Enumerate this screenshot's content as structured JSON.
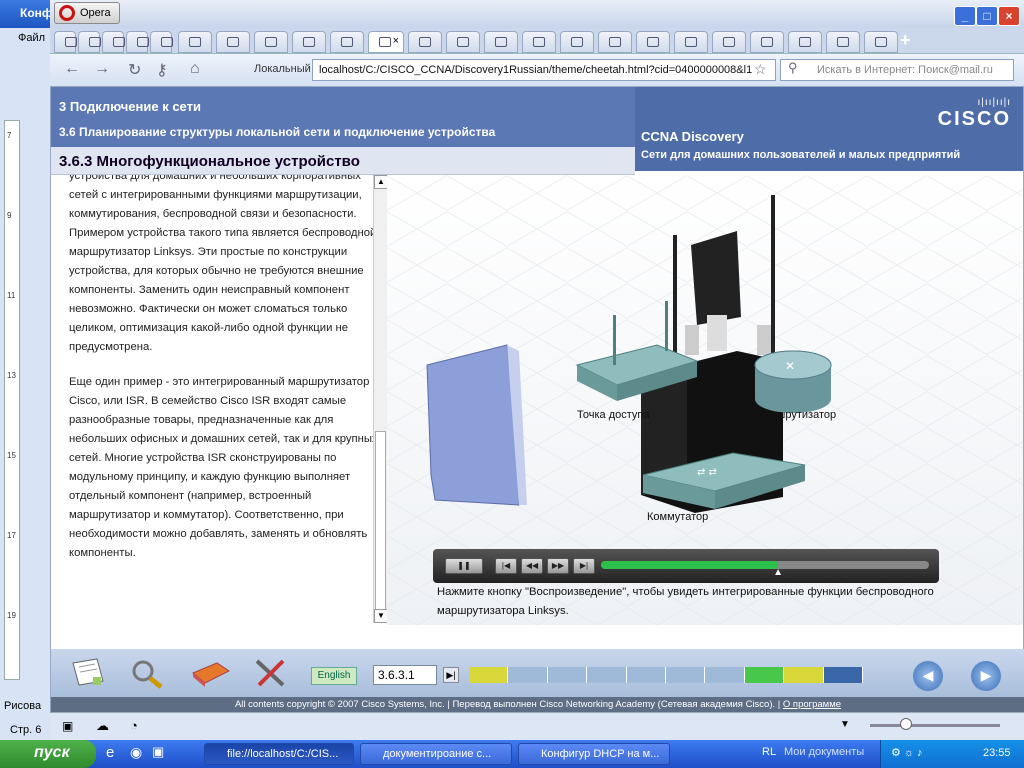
{
  "word": {
    "title": "Конф",
    "menu_file": "Файл",
    "draw_label": "Рисова",
    "page_label": "Стр. 6"
  },
  "opera": {
    "menu_label": "Opera",
    "security_label": "Локальный",
    "url": "localhost/C:/CISCO_CCNA/Discovery1Russian/theme/cheetah.html?cid=0400000008&l1",
    "search_placeholder": "Искать в Интернет: Поиск@mail.ru"
  },
  "course": {
    "section_title": "3 Подключение к сети",
    "subsection_title": "3.6 Планирование структуры локальной сети и подключение устройства",
    "brand_title": "CCNA Discovery",
    "brand_subtitle": "Сети для домашних пользователей и малых предприятий",
    "logo_text": "CISCO",
    "topic_title": "3.6.3 Многофункциональное устройство",
    "paragraphs": [
      "устройства для домашних и небольших корпоративных сетей с интегрированными функциями маршрутизации, коммутирования, беспроводной связи и безопасности. Примером устройства такого типа является беспроводной маршрутизатор Linksys. Эти простые по конструкции устройства, для которых обычно не требуются внешние компоненты. Заменить один неисправный компонент невозможно. Фактически он может сломаться только целиком, оптимизация какой-либо одной функции не предусмотрена.",
      "Еще один пример - это интегрированный маршрутизатор Cisco, или ISR. В семейство Cisco ISR входят самые разнообразные товары, предназначенные как для небольших офисных и домашних сетей, так и для крупных сетей. Многие устройства ISR сконструированы по модульному принципу, и каждую функцию выполняет отдельный компонент (например, встроенный маршрутизатор и коммутатор). Соответственно, при необходимости можно добавлять, заменять и обновлять компоненты."
    ],
    "labels": {
      "access_point": "Точка доступа",
      "router": "Маршрутизатор",
      "switch": "Коммутатор"
    },
    "caption": "Нажмите кнопку \"Воспроизведение\", чтобы увидеть интегрированные функции беспроводного маршрутизатора Linksys.",
    "playback_progress": 0.54,
    "language_label": "English",
    "page_number": "3.6.3.1",
    "footer_text": "All contents copyright © 2007 Cisco Systems, Inc. | Перевод выполнен Cisco Networking Academy (Сетевая академия Cisco). | ",
    "footer_link": "О программе",
    "segment_colors": [
      "#d8d83a",
      "#9fb9d8",
      "#9fb9d8",
      "#9fb9d8",
      "#9fb9d8",
      "#9fb9d8",
      "#9fb9d8",
      "#48c84a",
      "#d8d83a",
      "#3a66a8"
    ]
  },
  "taskbar": {
    "start_label": "пуск",
    "tasks": [
      "file://localhost/C:/CIS...",
      "документироание с...",
      "Конфигур DHCP на м..."
    ],
    "tray_lang": "RL",
    "tray_docs": "Мои документы",
    "clock": "23:55"
  }
}
